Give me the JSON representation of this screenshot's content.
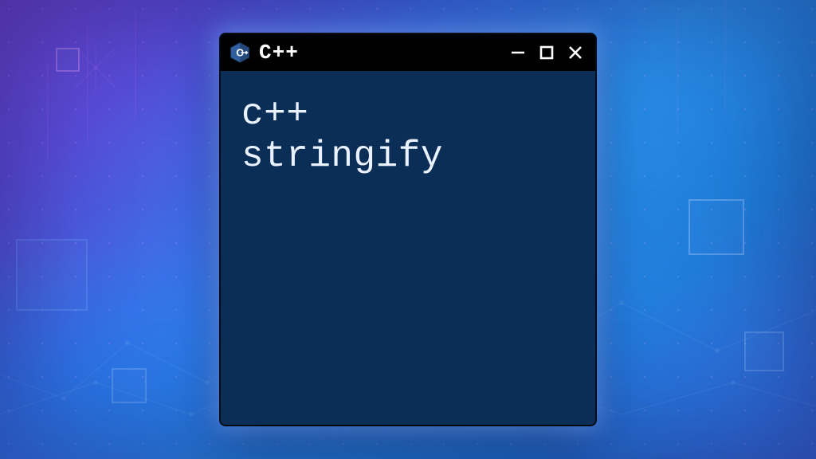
{
  "window": {
    "title": "C++",
    "icon": "cpp-hex-icon",
    "controls": {
      "minimize": "minimize",
      "maximize": "maximize",
      "close": "close"
    }
  },
  "content": {
    "line1": "c++",
    "line2": "stringify"
  },
  "colors": {
    "titlebar_bg": "#000000",
    "window_bg": "#0b2e57",
    "text": "#eaf2ff",
    "icon_blue": "#2f5f9e"
  }
}
